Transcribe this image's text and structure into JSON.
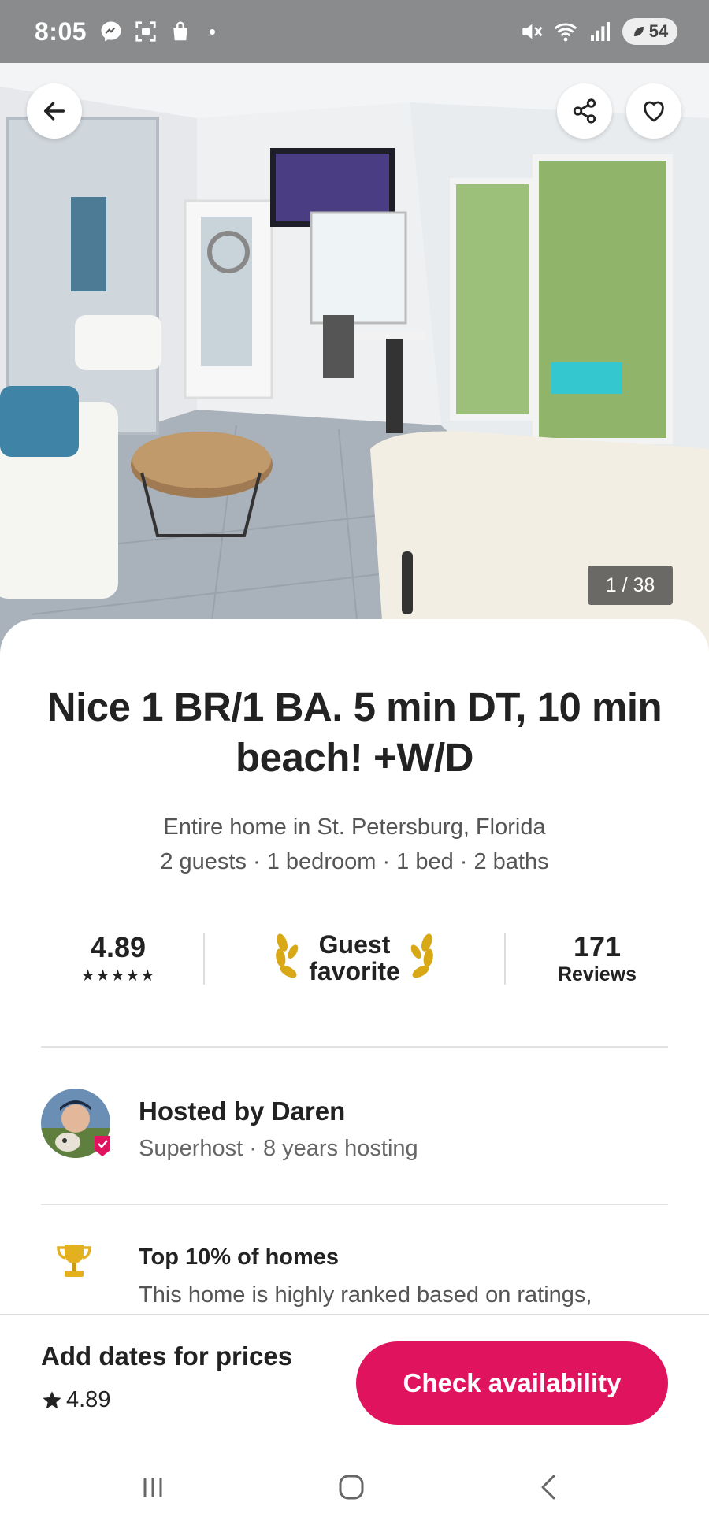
{
  "status_bar": {
    "time": "8:05",
    "battery": "54",
    "left_icons": [
      "messenger-icon",
      "screenshot-icon",
      "shopping-bag-icon"
    ],
    "right_icons": [
      "mute-icon",
      "wifi-icon",
      "signal-icon",
      "battery-icon"
    ]
  },
  "hero": {
    "photo_counter": "1 / 38",
    "buttons": [
      "back-arrow-icon",
      "share-icon",
      "heart-icon"
    ]
  },
  "listing": {
    "title": "Nice 1 BR/1 BA. 5 min DT, 10 min beach! +W/D",
    "subtitle": "Entire home in St. Petersburg, Florida",
    "details": "2 guests · 1 bedroom · 1 bed · 2 baths"
  },
  "stats": {
    "rating": "4.89",
    "stars": "★★★★★",
    "guest_favorite_line1": "Guest",
    "guest_favorite_line2": "favorite",
    "reviews_count": "171",
    "reviews_label": "Reviews"
  },
  "host": {
    "name": "Hosted by Daren",
    "sub": "Superhost · 8 years hosting"
  },
  "highlight": {
    "title": "Top 10% of homes",
    "description": "This home is highly ranked based on ratings,"
  },
  "booking_bar": {
    "prompt": "Add dates for prices",
    "rating": "4.89",
    "cta_label": "Check availability"
  },
  "colors": {
    "accent": "#e0135e",
    "text": "#222222",
    "muted": "#555555"
  }
}
